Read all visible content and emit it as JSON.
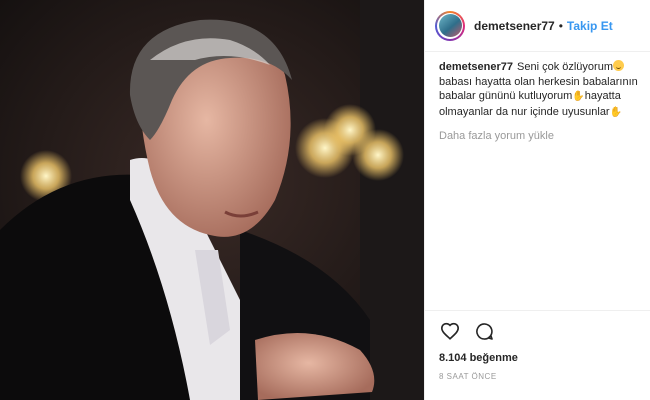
{
  "post": {
    "username": "demetsener77",
    "separator": "•",
    "follow_label": "Takip Et",
    "caption": {
      "username": "demetsener77",
      "part1": "Seni çok özlüyorum",
      "part2": " babası hayatta olan herkesin babalarının babalar gününü kutluyorum",
      "part3": "hayatta olmayanlar da nur içinde uyusunlar"
    },
    "load_more_label": "Daha fazla yorum yükle",
    "likes_text": "8.104 beğenme",
    "time_text": "8 SAAT ÖNCE",
    "icons": [
      "heart-icon",
      "comment-icon"
    ],
    "emoji": [
      "smiling-face-emoji",
      "folded-hands-emoji"
    ],
    "colors": {
      "link": "#3897f0",
      "text": "#262626",
      "muted": "#999999"
    }
  }
}
